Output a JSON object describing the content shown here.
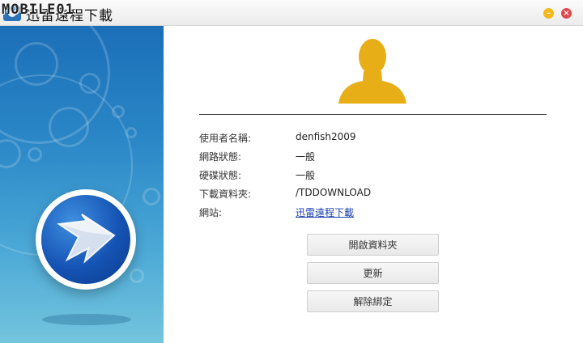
{
  "window": {
    "title": "迅雷遠程下載",
    "watermark": "MOBILE01",
    "minimize_label": "–",
    "close_label": "×"
  },
  "colors": {
    "sidebar_top": "#1b6fb8",
    "sidebar_bottom": "#74c5dd",
    "avatar": "#e8ae17",
    "minimize": "#f3b81a",
    "close": "#e3474b",
    "link": "#1a3fb0"
  },
  "icons": {
    "app": "app-logo-icon",
    "avatar": "user-silhouette-icon",
    "brand": "arrow-circle-logo-icon"
  },
  "user_info": {
    "rows": [
      {
        "label": "使用者名稱:",
        "value": "denfish2009"
      },
      {
        "label": "網路狀態:",
        "value": "一般"
      },
      {
        "label": "硬碟狀態:",
        "value": "一般"
      },
      {
        "label": "下載資料夾:",
        "value": "/TDDOWNLOAD"
      },
      {
        "label": "網站:",
        "value": "迅雷遠程下載"
      }
    ]
  },
  "actions": {
    "open_folder": "開啟資料夾",
    "update": "更新",
    "unbind": "解除綁定"
  }
}
